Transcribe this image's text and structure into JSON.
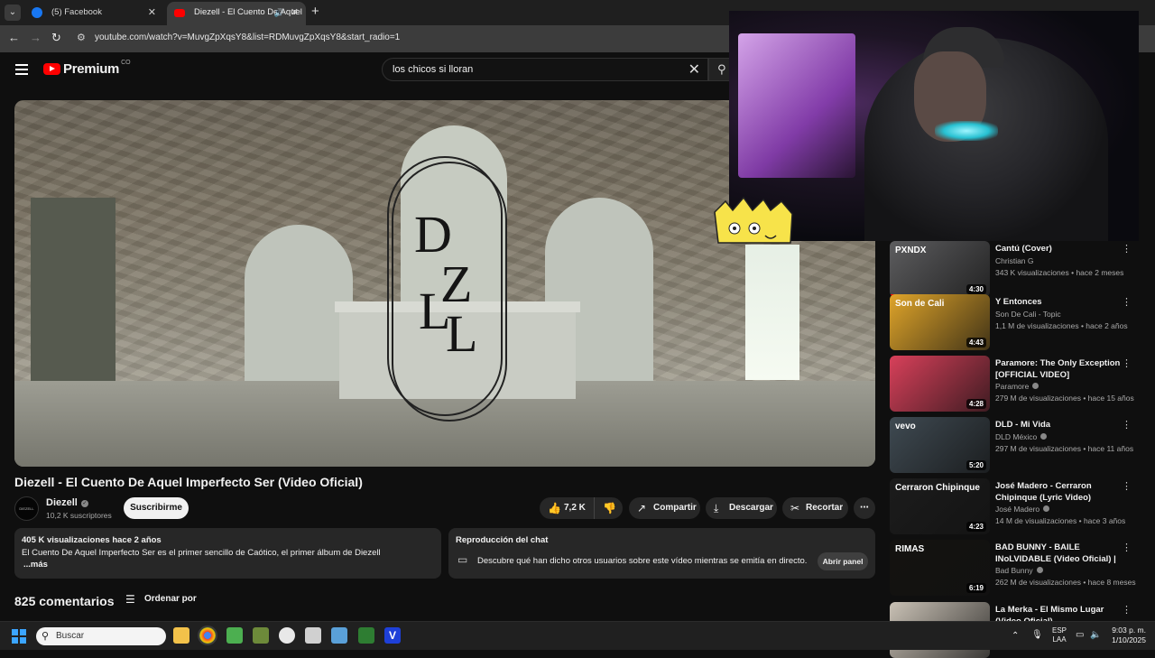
{
  "browser": {
    "tabs": [
      {
        "title": "(5) Facebook",
        "favicon_color": "#1877f2"
      },
      {
        "title": "Diezell - El Cuento De Aquel",
        "favicon_color": "#ff0000"
      }
    ],
    "url": "youtube.com/watch?v=MuvgZpXqsY8&list=RDMuvgZpXqsY8&start_radio=1"
  },
  "yt": {
    "logo_text": "Premium",
    "country": "CO",
    "search_query": "los chicos si lloran"
  },
  "player": {
    "logo_letters": [
      "D",
      "Z",
      "L",
      "L"
    ]
  },
  "video": {
    "title": "Diezell - El Cuento De Aquel Imperfecto Ser (Video Oficial)",
    "channel": "Diezell",
    "subscribers": "10,2 K suscriptores",
    "avatar_text": "DIEZELL",
    "subscribe_label": "Suscribirme",
    "likes": "7,2 K",
    "share_label": "Compartir",
    "download_label": "Descargar",
    "clip_label": "Recortar",
    "meta": "405 K visualizaciones  hace 2 años",
    "description": "El Cuento De Aquel Imperfecto Ser es el primer sencillo de Caótico, el primer álbum de Diezell",
    "more": "...más"
  },
  "chat": {
    "title": "Reproducción del chat",
    "text": "Descubre qué han dicho otros usuarios sobre este vídeo mientras se emitía en directo.",
    "button": "Abrir panel"
  },
  "comments": {
    "count": "825 comentarios",
    "sort_label": "Ordenar por"
  },
  "recommendations": [
    {
      "title": "Cantú (Cover)",
      "channel": "Christian G",
      "stats": "343 K visualizaciones • hace 2 meses",
      "duration": "4:30",
      "verified": false,
      "thumb_text": "PXNDX",
      "progress": 0.08,
      "thumb_color": "#5d5d5f"
    },
    {
      "title": "Y Entonces",
      "channel": "Son De Cali - Topic",
      "stats": "1,1 M de visualizaciones • hace 2 años",
      "duration": "4:43",
      "verified": false,
      "thumb_text": "Son de Cali",
      "progress": 0.0,
      "thumb_color": "#e0a52a"
    },
    {
      "title": "Paramore: The Only Exception [OFFICIAL VIDEO]",
      "channel": "Paramore",
      "stats": "279 M de visualizaciones • hace 15 años",
      "duration": "4:28",
      "verified": true,
      "thumb_text": "",
      "progress": 0.0,
      "thumb_color": "#d8405a"
    },
    {
      "title": "DLD - Mi Vida",
      "channel": "DLD México",
      "stats": "297 M de visualizaciones • hace 11 años",
      "duration": "5:20",
      "verified": true,
      "thumb_text": "vevo",
      "progress": 0.0,
      "thumb_color": "#3f4a52"
    },
    {
      "title": "José Madero - Cerraron Chipinque (Lyric Video)",
      "channel": "José Madero",
      "stats": "14 M de visualizaciones • hace 3 años",
      "duration": "4:23",
      "verified": true,
      "thumb_text": "Cerraron Chipinque",
      "progress": 0.0,
      "thumb_color": "#1c1c1c"
    },
    {
      "title": "BAD BUNNY - BAILE INoLVIDABLE (Video Oficial) | ...",
      "channel": "Bad Bunny",
      "stats": "262 M de visualizaciones • hace 8 meses",
      "duration": "6:19",
      "verified": true,
      "thumb_text": "RIMAS",
      "progress": 0.0,
      "thumb_color": "#141210"
    },
    {
      "title": "La Merka - El Mismo Lugar (Video Oficial)",
      "channel": "",
      "stats": "",
      "duration": "",
      "verified": false,
      "thumb_text": "",
      "progress": 0.0,
      "thumb_color": "#c9c1b5"
    }
  ],
  "taskbar": {
    "search_placeholder": "Buscar",
    "lang": "ESP",
    "lang_sub": "LAA",
    "time": "9:03 p. m.",
    "date": "1/10/2025"
  }
}
